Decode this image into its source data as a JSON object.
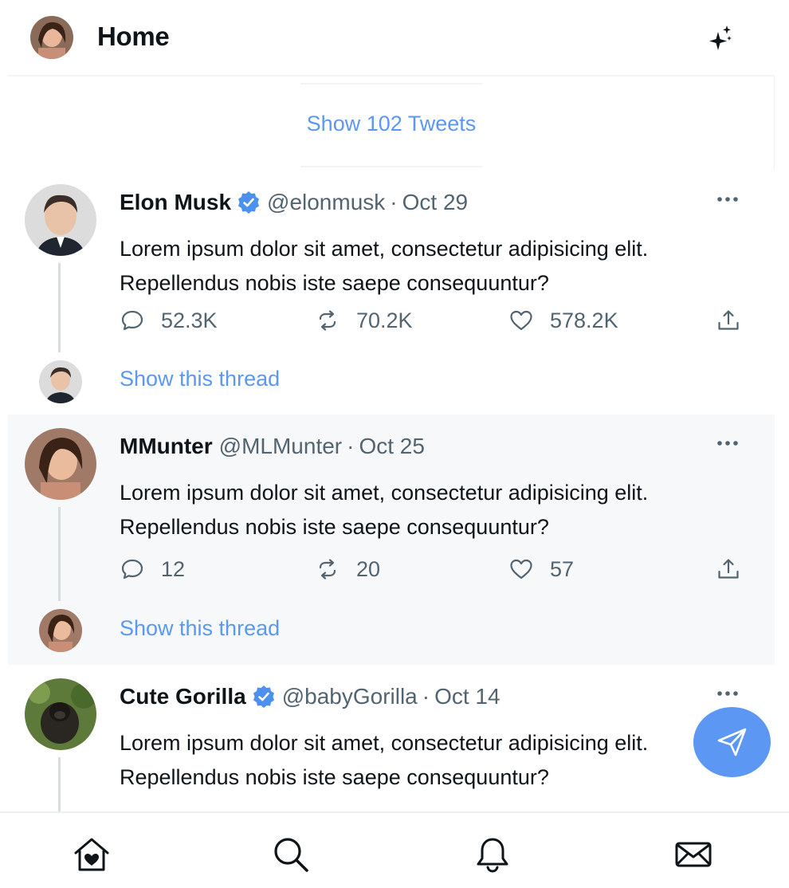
{
  "header": {
    "title": "Home",
    "sparkle_icon": "sparkle-icon"
  },
  "feed": {
    "show_tweets_label": "Show 102 Tweets"
  },
  "tweets": [
    {
      "name": "Elon Musk",
      "verified": true,
      "handle": "@elonmusk",
      "separator": "·",
      "date": "Oct 29",
      "text": "Lorem ipsum dolor sit amet, consectetur adipisicing elit. Repellendus nobis iste saepe consequuntur?",
      "replies": "52.3K",
      "retweets": "70.2K",
      "likes": "578.2K",
      "show_thread_label": "Show this thread"
    },
    {
      "name": "MMunter",
      "verified": false,
      "handle": "@MLMunter",
      "separator": "·",
      "date": "Oct 25",
      "text": "Lorem ipsum dolor sit amet, consectetur adipisicing elit. Repellendus nobis iste saepe consequuntur?",
      "replies": "12",
      "retweets": "20",
      "likes": "57",
      "show_thread_label": "Show this thread"
    },
    {
      "name": "Cute Gorilla",
      "verified": true,
      "handle": "@babyGorilla",
      "separator": "·",
      "date": "Oct 14",
      "text": "Lorem ipsum dolor sit amet, consectetur adipisicing elit. Repellendus nobis iste saepe consequuntur?"
    }
  ],
  "bottom_nav": {
    "items": [
      "home-icon",
      "search-icon",
      "bell-icon",
      "mail-icon"
    ]
  },
  "colors": {
    "accent": "#5a98f2",
    "verified": "#4d91f0",
    "muted": "#536471",
    "fab": "#5b97f3"
  }
}
